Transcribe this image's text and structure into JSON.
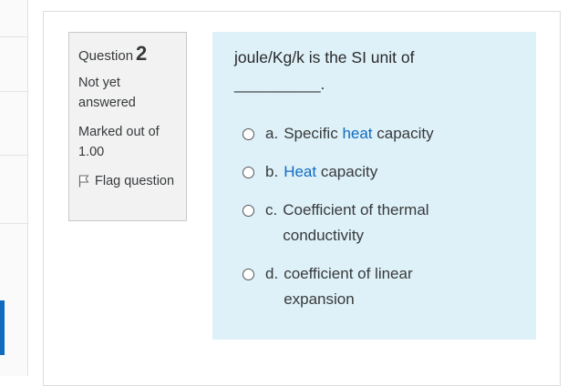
{
  "question": {
    "label": "Question",
    "number": "2",
    "state": "Not yet answered",
    "marks_label": "Marked out of",
    "marks_value": "1.00",
    "flag_label": "Flag question",
    "text": "joule/Kg/k is the SI unit of",
    "blank": "__________."
  },
  "options": [
    {
      "letter": "a.",
      "pre": "Specific ",
      "hl": "heat",
      "post": " capacity"
    },
    {
      "letter": "b.",
      "pre": "",
      "hl": "Heat",
      "post": " capacity"
    },
    {
      "letter": "c.",
      "pre": "Coefficient of thermal conductivity",
      "hl": "",
      "post": ""
    },
    {
      "letter": "d.",
      "pre": "coefficient of linear expansion",
      "hl": "",
      "post": ""
    }
  ],
  "colors": {
    "accent": "#0f6cbf",
    "content_bg": "#def0f8",
    "info_bg": "#f2f2f2"
  },
  "icons": {
    "flag": "flag-icon",
    "radio": "radio-unchecked-icon"
  }
}
